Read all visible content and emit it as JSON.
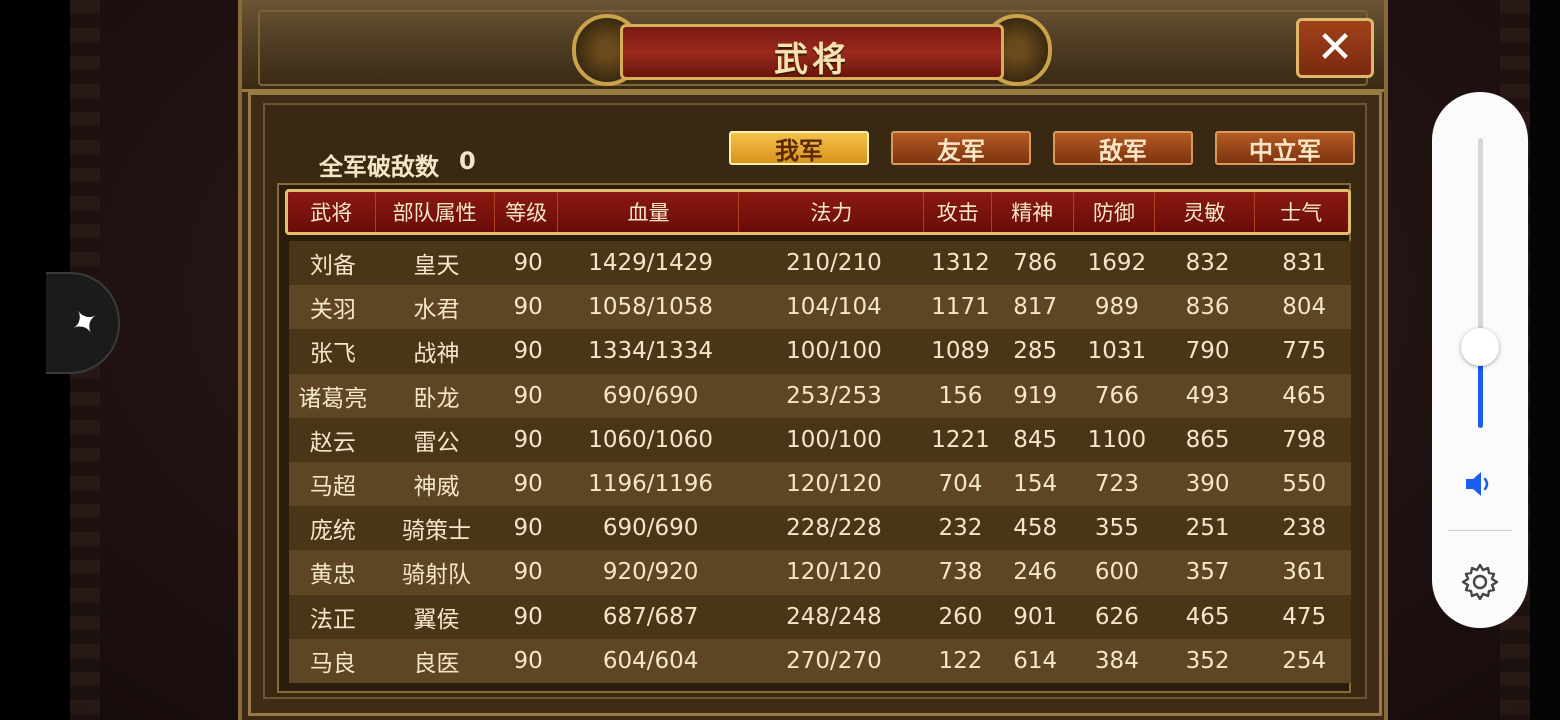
{
  "window": {
    "title": "武将"
  },
  "close_button": {
    "label": "✕"
  },
  "summary": {
    "label": "全军破敌数",
    "value": "0"
  },
  "tabs": [
    {
      "label": "我军",
      "active": true
    },
    {
      "label": "友军",
      "active": false
    },
    {
      "label": "敌军",
      "active": false
    },
    {
      "label": "中立军",
      "active": false
    }
  ],
  "table": {
    "headers": [
      "武将",
      "部队属性",
      "等级",
      "血量",
      "法力",
      "攻击",
      "精神",
      "防御",
      "灵敏",
      "士气"
    ],
    "rows": [
      [
        "刘备",
        "皇天",
        "90",
        "1429/1429",
        "210/210",
        "1312",
        "786",
        "1692",
        "832",
        "831"
      ],
      [
        "关羽",
        "水君",
        "90",
        "1058/1058",
        "104/104",
        "1171",
        "817",
        "989",
        "836",
        "804"
      ],
      [
        "张飞",
        "战神",
        "90",
        "1334/1334",
        "100/100",
        "1089",
        "285",
        "1031",
        "790",
        "775"
      ],
      [
        "诸葛亮",
        "卧龙",
        "90",
        "690/690",
        "253/253",
        "156",
        "919",
        "766",
        "493",
        "465"
      ],
      [
        "赵云",
        "雷公",
        "90",
        "1060/1060",
        "100/100",
        "1221",
        "845",
        "1100",
        "865",
        "798"
      ],
      [
        "马超",
        "神威",
        "90",
        "1196/1196",
        "120/120",
        "704",
        "154",
        "723",
        "390",
        "550"
      ],
      [
        "庞统",
        "骑策士",
        "90",
        "690/690",
        "228/228",
        "232",
        "458",
        "355",
        "251",
        "238"
      ],
      [
        "黄忠",
        "骑射队",
        "90",
        "920/920",
        "120/120",
        "738",
        "246",
        "600",
        "357",
        "361"
      ],
      [
        "法正",
        "翼侯",
        "90",
        "687/687",
        "248/248",
        "260",
        "901",
        "626",
        "465",
        "475"
      ],
      [
        "马良",
        "良医",
        "90",
        "604/604",
        "270/270",
        "122",
        "614",
        "384",
        "352",
        "254"
      ]
    ]
  },
  "volume_overlay": {
    "level": 0.28,
    "speaker_icon": "speaker-icon",
    "settings_icon": "gear-icon",
    "accent": "#1a5bf0"
  },
  "floating_button": {
    "icon": "app-shortcut-icon"
  }
}
